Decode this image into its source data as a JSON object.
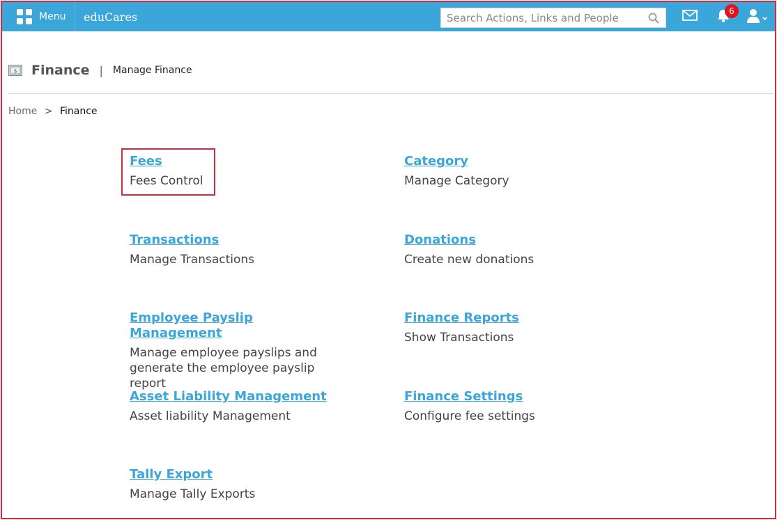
{
  "topbar": {
    "menu_label": "Menu",
    "brand": "eduCares",
    "search_placeholder": "Search Actions, Links and People",
    "notification_count": "6"
  },
  "page": {
    "title": "Finance",
    "separator": "|",
    "subtitle": "Manage Finance"
  },
  "breadcrumb": {
    "home": "Home",
    "separator": ">",
    "current": "Finance"
  },
  "items": [
    {
      "title": "Fees",
      "description": "Fees Control"
    },
    {
      "title": "Category",
      "description": "Manage Category"
    },
    {
      "title": "Transactions",
      "description": "Manage Transactions"
    },
    {
      "title": "Donations",
      "description": "Create new donations"
    },
    {
      "title": "Employee Payslip Management",
      "description": "Manage employee payslips and generate the employee payslip report"
    },
    {
      "title": "Finance Reports",
      "description": "Show Transactions"
    },
    {
      "title": "Asset Liability Management",
      "description": "Asset liability Management"
    },
    {
      "title": "Finance Settings",
      "description": "Configure fee settings"
    },
    {
      "title": "Tally Export",
      "description": "Manage Tally Exports"
    }
  ],
  "colors": {
    "topbar": "#3aa6da",
    "link": "#3aa6da",
    "highlight": "#d3293a",
    "badge": "#e0131e"
  }
}
